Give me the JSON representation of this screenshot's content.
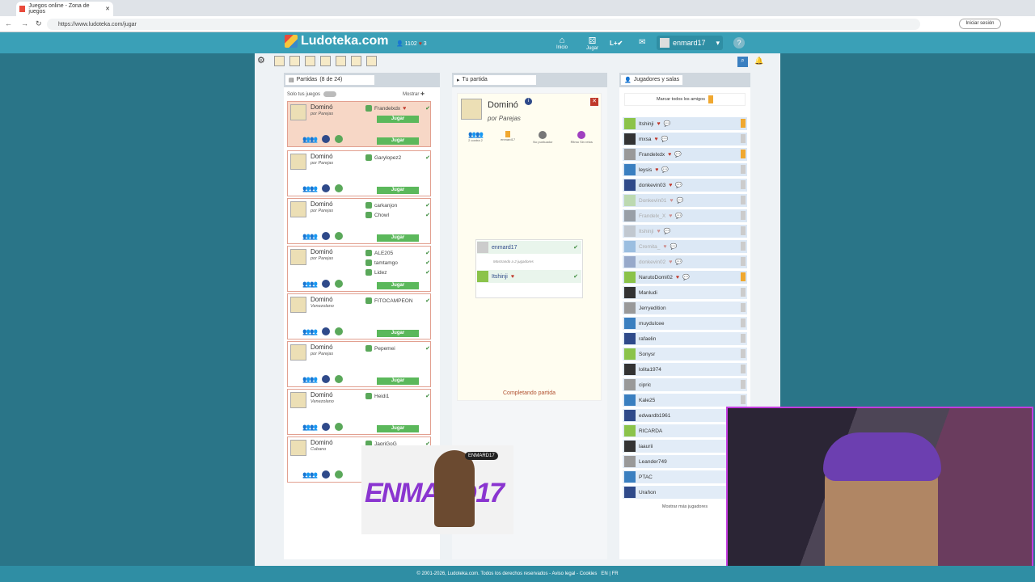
{
  "browser": {
    "tab_title": "Juegos online - Zona de juegos",
    "url": "https://www.ludoteka.com/jugar",
    "signin": "Iniciar sesión"
  },
  "header": {
    "logo": "Ludoteka.com",
    "points": "1102",
    "hearts": "3",
    "nav": [
      "Inicio",
      "Jugar"
    ],
    "username": "enmard17"
  },
  "left": {
    "title": "Partidas",
    "count": "(8 de 24)",
    "solo": "Solo tus juegos",
    "mostrar": "Mostrar",
    "jugar": "Jugar",
    "cards": [
      {
        "name": "Dominó",
        "sub": "por Parejas",
        "players": [
          "Frandelxdx"
        ],
        "active": true
      },
      {
        "name": "Dominó",
        "sub": "por Parejas",
        "players": [
          "Garylopez2"
        ]
      },
      {
        "name": "Dominó",
        "sub": "por Parejas",
        "players": [
          "carkanjon",
          "Chowl"
        ]
      },
      {
        "name": "Dominó",
        "sub": "por Parejas",
        "players": [
          "ALE205",
          "tamtamgo",
          "Lidez"
        ]
      },
      {
        "name": "Dominó",
        "sub": "Venezolano",
        "players": [
          "FITOCAMPEON"
        ]
      },
      {
        "name": "Dominó",
        "sub": "por Parejas",
        "players": [
          "Pepemei"
        ]
      },
      {
        "name": "Dominó",
        "sub": "Venezolano",
        "players": [
          "Heidi1"
        ]
      },
      {
        "name": "Dominó",
        "sub": "Cubano",
        "players": [
          "JagriGoG"
        ]
      }
    ]
  },
  "middle": {
    "title": "Tu partida",
    "game": "Dominó",
    "sub": "por Parejas",
    "opts": [
      "2 contra 2",
      "enmard17",
      "No puntuador",
      "Ritmo Sin retos"
    ],
    "players": [
      "enmard17",
      "Itshinji"
    ],
    "showing": "Mostrando a 2 jugadores",
    "status": "Completando partida"
  },
  "right": {
    "title": "Jugadores y salas",
    "mark_all": "Marcar todos los amigos",
    "more": "Mostrar más jugadores",
    "users": [
      {
        "n": "Itshinji",
        "h": true,
        "c": true,
        "bm": true
      },
      {
        "n": "mxsa",
        "h": true,
        "c": true
      },
      {
        "n": "Frandelxdx",
        "h": true,
        "c": true,
        "bm": true
      },
      {
        "n": "leysis",
        "h": true,
        "c": true
      },
      {
        "n": "donkevin03",
        "h": true,
        "c": true
      },
      {
        "n": "Donkevin01",
        "h": true,
        "c": true,
        "g": true
      },
      {
        "n": "Frandelx_X",
        "h": true,
        "c": true,
        "g": true
      },
      {
        "n": "Itshinji",
        "h": true,
        "c": true,
        "g": true
      },
      {
        "n": "Cremita_",
        "h": true,
        "c": true,
        "g": true
      },
      {
        "n": "donkevin02",
        "h": true,
        "c": true,
        "g": true
      },
      {
        "n": "NarutoDomi02",
        "h": true,
        "c": true,
        "bm": true
      },
      {
        "n": "Manludi"
      },
      {
        "n": "Jerryedition"
      },
      {
        "n": "muydulcee"
      },
      {
        "n": "rafaelin"
      },
      {
        "n": "Sonysr"
      },
      {
        "n": "lolita1974"
      },
      {
        "n": "cipric"
      },
      {
        "n": "Kale25"
      },
      {
        "n": "edwardb1961"
      },
      {
        "n": "RICARDA"
      },
      {
        "n": "laaurii"
      },
      {
        "n": "Leander749"
      },
      {
        "n": "PTAC"
      },
      {
        "n": "Uraňon"
      }
    ]
  },
  "footer": "© 2001-2026, Ludoteka.com. Todos los derechos reservados - Aviso legal - Cookies",
  "footer_langs": "EN | FR",
  "overlay": {
    "streamer_tag": "ENMARD17",
    "banner": "ENMARD17"
  }
}
